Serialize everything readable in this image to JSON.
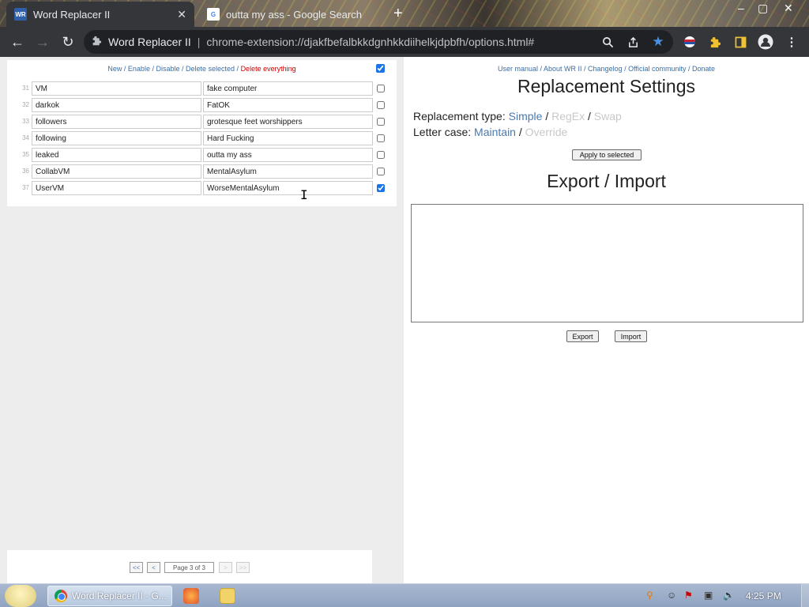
{
  "browser": {
    "tabs": [
      {
        "title": "Word Replacer II",
        "favicon": "wr-icon",
        "active": true,
        "close": "✕"
      },
      {
        "title": "outta my ass - Google Search",
        "favicon": "google-icon",
        "active": false
      }
    ],
    "new_tab": "+",
    "window_controls": {
      "minimize": "–",
      "maximize": "▢",
      "close": "✕"
    },
    "nav": {
      "back": "←",
      "forward": "→",
      "reload": "↻"
    },
    "omnibox": {
      "site_label": "Word Replacer II",
      "separator": "|",
      "url": "chrome-extension://djakfbefalbkkdgnhkkdiihelkjdpbfh/options.html#"
    },
    "toolbar_icons": [
      "zoom-icon",
      "share-icon",
      "bookmark-star-icon",
      "extension-flag-icon",
      "puzzle-icon",
      "sidepanel-icon",
      "profile-icon",
      "menu-icon"
    ]
  },
  "left": {
    "actions": {
      "new": "New",
      "enable": "Enable",
      "disable": "Disable",
      "delete_selected": "Delete selected",
      "delete_everything": "Delete everything",
      "sep": " / "
    },
    "select_all_checked": true,
    "rows": [
      {
        "num": "31",
        "find": "VM",
        "replace": "fake computer",
        "checked": false
      },
      {
        "num": "32",
        "find": "darkok",
        "replace": "FatOK",
        "checked": false
      },
      {
        "num": "33",
        "find": "followers",
        "replace": "grotesque feet worshippers",
        "checked": false
      },
      {
        "num": "34",
        "find": "following",
        "replace": "Hard Fucking",
        "checked": false
      },
      {
        "num": "35",
        "find": "leaked",
        "replace": "outta my ass",
        "checked": false
      },
      {
        "num": "36",
        "find": "CollabVM",
        "replace": "MentalAsylum",
        "checked": false
      },
      {
        "num": "37",
        "find": "UserVM",
        "replace": "WorseMentalAsylum",
        "checked": true
      }
    ],
    "pager": {
      "first": "<<",
      "prev": "<",
      "page_label": "Page 3 of 3",
      "next": ">",
      "last": ">>"
    }
  },
  "right": {
    "links": {
      "manual": "User manual",
      "about": "About WR II",
      "changelog": "Changelog",
      "community": "Official community",
      "donate": "Donate",
      "sep": " / "
    },
    "settings_title": "Replacement Settings",
    "replacement_type": {
      "label": "Replacement type:",
      "options": [
        "Simple",
        "RegEx",
        "Swap"
      ],
      "selected": "Simple"
    },
    "letter_case": {
      "label": "Letter case:",
      "options": [
        "Maintain",
        "Override"
      ],
      "selected": "Maintain"
    },
    "apply_button": "Apply to selected",
    "export_title": "Export / Import",
    "export_text": "",
    "export_button": "Export",
    "import_button": "Import"
  },
  "taskbar": {
    "chrome_button": "Word Replacer II - G...",
    "clock": "4:25 PM",
    "tray_icons": [
      "search-tray-icon",
      "smiley-tray-icon",
      "flag-tray-icon",
      "network-tray-icon",
      "volume-tray-icon"
    ]
  },
  "colors": {
    "link": "#3b6ea5",
    "danger": "#cc0000",
    "active_option": "#4a7ab0",
    "inactive_option": "#c8c8c8",
    "chrome_dark": "#35363a"
  }
}
